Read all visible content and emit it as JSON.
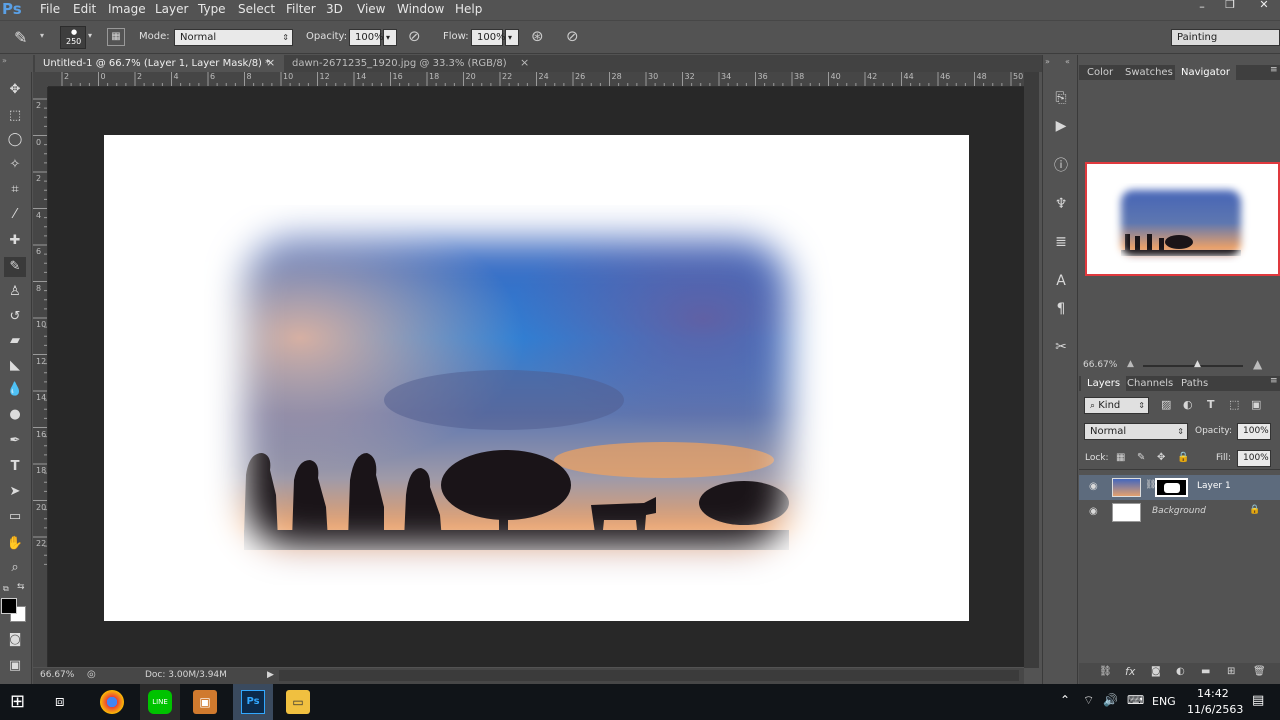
{
  "menubar": {
    "logo": "Ps",
    "items": [
      "File",
      "Edit",
      "Image",
      "Layer",
      "Type",
      "Select",
      "Filter",
      "3D",
      "View",
      "Window",
      "Help"
    ]
  },
  "options": {
    "brush_size": "250",
    "mode_label": "Mode:",
    "mode_value": "Normal",
    "opacity_label": "Opacity:",
    "opacity_value": "100%",
    "flow_label": "Flow:",
    "flow_value": "100%",
    "workspace": "Painting"
  },
  "doctabs": [
    {
      "label": "Untitled-1 @ 66.7% (Layer 1, Layer Mask/8) *",
      "close": "×"
    },
    {
      "label": "dawn-2671235_1920.jpg @ 33.3% (RGB/8)",
      "close": "×"
    }
  ],
  "ruler_top": [
    "2",
    "0",
    "2",
    "4",
    "6",
    "8",
    "10",
    "12",
    "14",
    "16",
    "18",
    "20",
    "22",
    "24",
    "26",
    "28",
    "30",
    "32",
    "34",
    "36",
    "38",
    "40",
    "42",
    "44",
    "46",
    "48",
    "50"
  ],
  "ruler_left": [
    "2",
    "0",
    "2",
    "4",
    "6",
    "8",
    "10",
    "12",
    "14",
    "16",
    "18",
    "20",
    "22"
  ],
  "status": {
    "zoom": "66.67%",
    "doc": "Doc: 3.00M/3.94M"
  },
  "panels": {
    "top_tabs": [
      "Color",
      "Swatches",
      "Navigator"
    ],
    "nav_zoom": "66.67%",
    "layer_tabs": [
      "Layers",
      "Channels",
      "Paths"
    ],
    "kind": "Kind",
    "blend": "Normal",
    "opacity_label": "Opacity:",
    "opacity_value": "100%",
    "lock_label": "Lock:",
    "fill_label": "Fill:",
    "fill_value": "100%",
    "layers": [
      {
        "name": "Layer 1",
        "selected": true
      },
      {
        "name": "Background",
        "selected": false
      }
    ]
  },
  "taskbar": {
    "lang": "ENG",
    "time": "14:42",
    "date": "11/6/2563"
  }
}
